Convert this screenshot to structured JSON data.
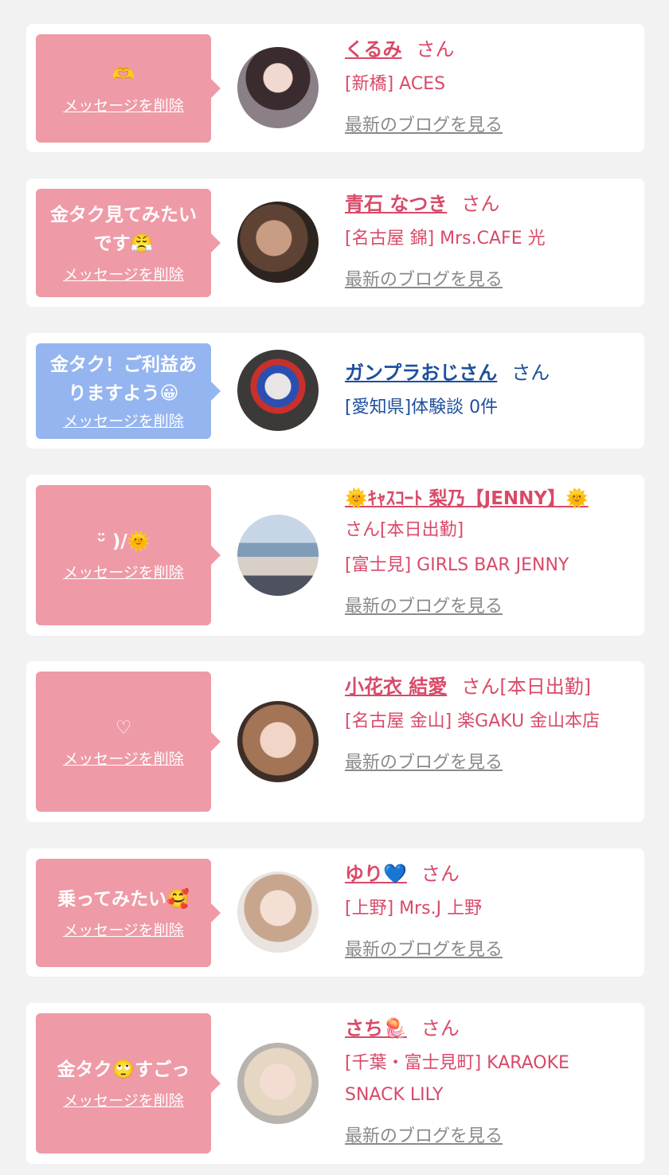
{
  "delete_label": "メッセージを削除",
  "blog_label": "最新のブログを見る",
  "colors": {
    "bubble_pink": "#ef9aa7",
    "bubble_blue": "#95b5f0",
    "name_pink": "#d94a68",
    "name_blue": "#1d4f9c",
    "link_gray": "#8a8a8a"
  },
  "entries": [
    {
      "message": "🫶",
      "name": "くるみ",
      "honorific": "さん",
      "store": "[新橋] ACES",
      "blog": "最新のブログを見る"
    },
    {
      "message": "金タク見てみたいです😤",
      "name": "青石 なつき",
      "honorific": "さん",
      "store": "[名古屋 錦] Mrs.CAFE 光",
      "blog": "最新のブログを見る"
    },
    {
      "message": "金タク！ご利益ありますよう😀",
      "name": "ガンプラおじさん",
      "honorific": "さん",
      "store": "[愛知県]体験談 0件"
    },
    {
      "message": "ᵕ̈ )/🌞",
      "name": "🌞ｷｬｽｺｰﾄ 梨乃【JENNY】🌞",
      "honorific": "さん[本日出勤]",
      "store": "[富士見] GIRLS BAR JENNY",
      "blog": "最新のブログを見る"
    },
    {
      "message": "♡",
      "name": "小花衣 結愛",
      "honorific": "さん[本日出勤]",
      "store": "[名古屋 金山] 楽GAKU 金山本店",
      "blog": "最新のブログを見る"
    },
    {
      "message": "乗ってみたい🥰",
      "name": "ゆり💙",
      "honorific": "さん",
      "store": "[上野] Mrs.J 上野",
      "blog": "最新のブログを見る"
    },
    {
      "message": "金タク🙄すごっ",
      "name": "さち🪼",
      "honorific": "さん",
      "store": "[千葉・富士見町] KARAOKE SNACK LILY",
      "blog": "最新のブログを見る"
    }
  ]
}
